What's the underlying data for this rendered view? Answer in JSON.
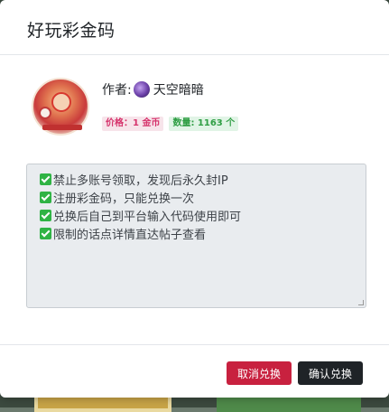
{
  "modal": {
    "title": "好玩彩金码"
  },
  "author": {
    "label": "作者:",
    "name": "天空暗暗"
  },
  "badges": {
    "price": "价格：1 金币",
    "quantity": "数量: 1163 个"
  },
  "rules": [
    "禁止多账号领取，发现后永久封IP",
    "注册彩金码，只能兑换一次",
    "兑换后自己到平台输入代码使用即可",
    "限制的话点详情直达帖子查看"
  ],
  "footer": {
    "cancel_label": "取消兑换",
    "confirm_label": "确认兑换"
  },
  "colors": {
    "cancel": "#c8213f",
    "confirm": "#1f2327",
    "price_badge_text": "#d6336c",
    "qty_badge_text": "#2f9e44",
    "check": "#2fb344"
  }
}
